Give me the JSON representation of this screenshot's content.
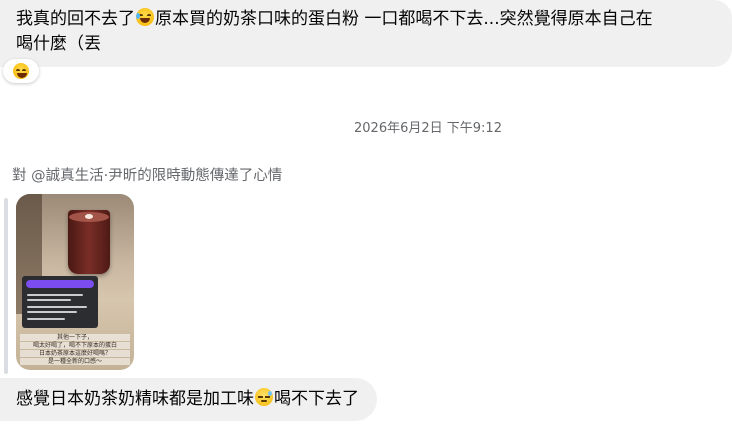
{
  "messages": {
    "first": {
      "line1_part1": "我真的回不去了",
      "line1_part2": "原本買的奶茶口味的蛋白粉 一口都喝不下去...突然覺得原本自己在",
      "line2": "喝什麼（丟",
      "inline_emoji": "rolling-on-floor-laughing-icon",
      "reaction_emoji": "laughing-face-icon"
    },
    "timestamp": "2026年6月2日 下午9:12",
    "reply": {
      "header": "對 @誠真生活·尹昕的限時動態傳達了心情",
      "story_text_lines": [
        "其他一下子，",
        "喝太好喝了，喝不下原本的蛋白",
        "日本奶茶原本這麼好喝嗎？",
        "是一種全新的口感～"
      ]
    },
    "last": {
      "part1": "感覺日本奶茶奶精味都是加工味",
      "part2": "喝不下去了",
      "inline_emoji": "downcast-sweat-face-icon"
    }
  },
  "colors": {
    "bubble_bg": "#f0f0f0",
    "muted_text": "#65676b",
    "reply_bar": "#dadde1"
  }
}
